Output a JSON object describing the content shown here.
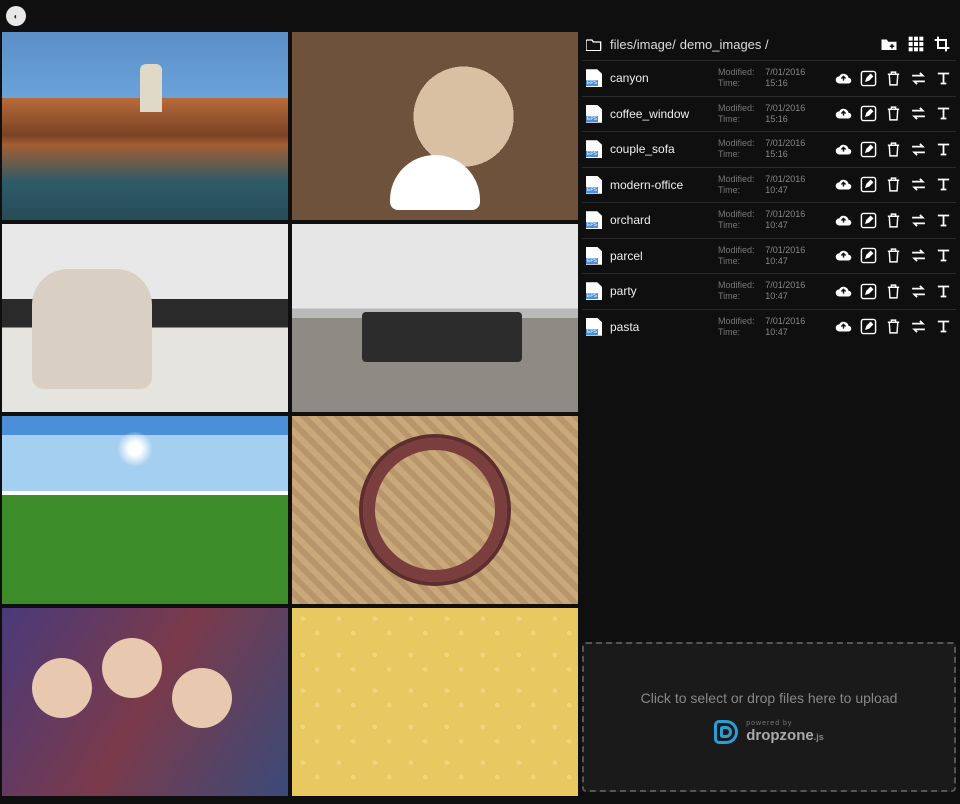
{
  "breadcrumb": {
    "parts": [
      "files/image/",
      "demo_images /"
    ]
  },
  "labels": {
    "modified": "Modified:",
    "time": "Time:"
  },
  "dropzone": {
    "prompt": "Click to select or drop files here to upload",
    "brand": "dropzone",
    "brand_suffix": ".js",
    "powered": "powered by"
  },
  "files": [
    {
      "name": "canyon",
      "date": "7/01/2016",
      "time": "15:16",
      "ext": "EPS",
      "thumb": "t-canyon"
    },
    {
      "name": "coffee_window",
      "date": "7/01/2016",
      "time": "15:16",
      "ext": "EPS",
      "thumb": "t-coffee"
    },
    {
      "name": "couple_sofa",
      "date": "7/01/2016",
      "time": "15:16",
      "ext": "EPS",
      "thumb": "t-couple"
    },
    {
      "name": "modern-office",
      "date": "7/01/2016",
      "time": "10:47",
      "ext": "EPS",
      "thumb": "t-office"
    },
    {
      "name": "orchard",
      "date": "7/01/2016",
      "time": "10:47",
      "ext": "EPS",
      "thumb": "t-orchard"
    },
    {
      "name": "parcel",
      "date": "7/01/2016",
      "time": "10:47",
      "ext": "EPS",
      "thumb": "t-parcel"
    },
    {
      "name": "party",
      "date": "7/01/2016",
      "time": "10:47",
      "ext": "EPS",
      "thumb": "t-party"
    },
    {
      "name": "pasta",
      "date": "7/01/2016",
      "time": "10:47",
      "ext": "EPS",
      "thumb": "t-pasta"
    }
  ]
}
